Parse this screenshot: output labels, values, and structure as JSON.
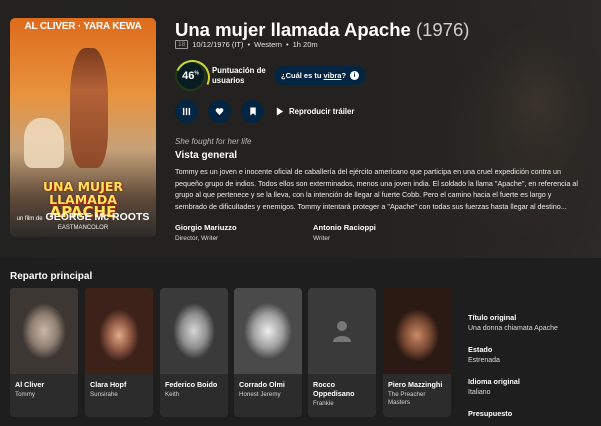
{
  "poster": {
    "actors": "AL CLIVER · YARA KEWA",
    "title_line1": "UNA MUJER LLAMADA",
    "title_line2": "APACHE",
    "director_prefix": "un film de",
    "director": "GEORGE Mc ROOTS",
    "process": "EASTMANCOLOR"
  },
  "movie": {
    "title": "Una mujer llamada Apache",
    "year": "(1976)",
    "certification": "18",
    "release": "10/12/1976 (IT)",
    "genre": "Western",
    "runtime": "1h 20m",
    "dot": "•"
  },
  "score": {
    "value": "46",
    "unit": "%",
    "percent": 46,
    "label": "Puntuación de usuarios",
    "vibe_prefix": "¿Cuál es tu ",
    "vibe_link": "vibra",
    "vibe_suffix": "?"
  },
  "actions": {
    "trailer_label": "Reproducir tráiler"
  },
  "tagline": "She fought for her life",
  "overview": {
    "heading": "Vista general",
    "text": "Tommy es un joven e inocente oficial de caballería del ejército americano que participa en una cruel expedición contra un pequeño grupo de indios. Todos ellos son exterminados, menos una joven india. El soldado la llama \"Apache\", en referencia al grupo al que pertenece y se la lleva, con la intención de llegar al fuerte Cobb. Pero el camino hacia el fuerte es largo y sembrado de dificultades y enemigos. Tommy intentará proteger a \"Apache\" con todas sus fuerzas hasta llegar al destino..."
  },
  "crew": [
    {
      "name": "Giorgio Mariuzzo",
      "role": "Director, Writer"
    },
    {
      "name": "Antonio Racioppi",
      "role": "Writer"
    }
  ],
  "cast_heading": "Reparto principal",
  "cast": [
    {
      "name": "Al Cliver",
      "character": "Tommy"
    },
    {
      "name": "Clara Hopf",
      "character": "Sunsirahe"
    },
    {
      "name": "Federico Boido",
      "character": "Keith"
    },
    {
      "name": "Corrado Olmi",
      "character": "Honest Jeremy"
    },
    {
      "name": "Rocco Oppedisano",
      "character": "Frankie"
    },
    {
      "name": "Piero Mazzinghi",
      "character": "The Preacher Masters"
    }
  ],
  "facts": [
    {
      "label": "Título original",
      "value": "Una donna chiamata Apache"
    },
    {
      "label": "Estado",
      "value": "Estrenada"
    },
    {
      "label": "Idioma original",
      "value": "Italiano"
    },
    {
      "label": "Presupuesto",
      "value": ""
    }
  ],
  "colors": {
    "accent_dark_blue": "#032541",
    "score_ring": "#d2d531",
    "background": "#1e1e1e"
  },
  "icons": {
    "list": "list-icon",
    "favorite": "heart-icon",
    "watchlist": "bookmark-icon",
    "play": "play-icon",
    "info": "info-icon",
    "placeholder": "person-placeholder-icon"
  }
}
